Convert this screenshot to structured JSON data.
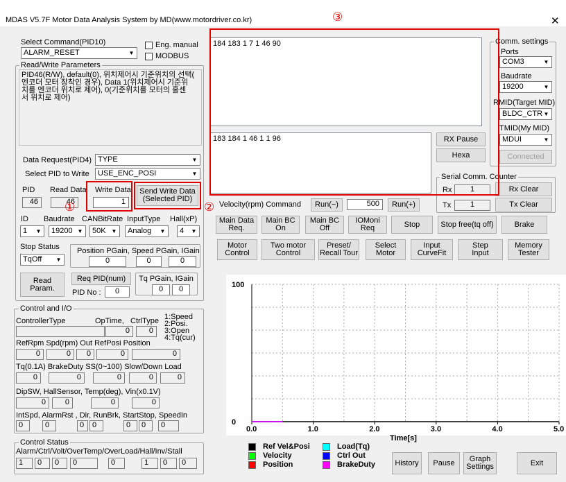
{
  "window": {
    "title": "MDAS V5.7F Motor Data Analysis System by MD(www.motordriver.co.kr)",
    "close": "✕"
  },
  "command": {
    "label": "Select Command(PID10)",
    "value": "ALARM_RESET",
    "eng_manual": "Eng. manual",
    "modbus": "MODBUS"
  },
  "rw": {
    "title": "Read/Write Parameters",
    "description": "PID46(R/W), default(0), 위치제어시 기준위치의 선택(\n엔코더 모터 장착인 경우), Data 1(위치제어시 기준위\n치를 엔코더 위치로 제어), 0(기준위치를 모터의 홀센\n서 위치로 제어)",
    "data_request_label": "Data Request(PID4)",
    "data_request_value": "TYPE",
    "select_pid_label": "Select PID to Write",
    "select_pid_value": "USE_ENC_POSI",
    "pid_label": "PID",
    "pid_value": "46",
    "read_data_label": "Read Data",
    "read_data_value": "46",
    "write_data_label": "Write Data",
    "write_data_value": "1",
    "send_button": "Send Write Data\n(Selected PID)",
    "id_label": "ID",
    "id_value": "1",
    "baud_label": "Baudrate",
    "baud_value": "19200",
    "can_label": "CANBitRate",
    "can_value": "50K",
    "inputtype_label": "InputType",
    "inputtype_value": "Analog",
    "hall_label": "Hall(xP)",
    "hall_value": "4",
    "stop_status_label": "Stop Status",
    "stop_status_value": "TqOff",
    "gains_label": "Position PGain, Speed PGain, IGain",
    "gains": [
      "0",
      "0",
      "0"
    ],
    "read_param": "Read\nParam.",
    "req_pid": "Req PID(num)",
    "pid_no_label": "PID No :",
    "pid_no_value": "0",
    "tq_label": "Tq PGain, IGain",
    "tq": [
      "0",
      "0"
    ]
  },
  "control_io": {
    "title": "Control and I/O",
    "controller_type": "ControllerType",
    "optime": "OpTime,",
    "ctrltype": "CtrlType",
    "ctrl_legend": [
      "1:Speed",
      "2:Posi.",
      "3:Open",
      "4:Tq(cur)"
    ],
    "optime_value": "0",
    "ctrltype_value": "0",
    "row1_label": "RefRpm  Spd(rpm)  Out  RefPosi     Position",
    "row1": [
      "0",
      "0",
      "0",
      "0",
      "0"
    ],
    "row2_label": "Tq(0.1A)  BrakeDuty  SS(0~100)  Slow/Down  Load",
    "row2": [
      "0",
      "0",
      "0",
      "0",
      "0"
    ],
    "row3_label": "DipSW,  HallSensor,     Temp(deg),  Vin(x0.1V)",
    "row3": [
      "0",
      "0",
      "0",
      "0"
    ],
    "row4_label": "IntSpd,  AlarmRst ,  Dir,  RunBrk,  StartStop,  SpeedIn",
    "row4": [
      "0",
      "0",
      "0",
      "0",
      "0",
      "0",
      "0"
    ]
  },
  "control_status": {
    "title": "Control Status",
    "label": "Alarm/Ctrl/Volt/OverTemp/OverLoad/Hall/Inv/Stall",
    "values": [
      "1",
      "0",
      "0",
      "0",
      "0",
      "1",
      "0",
      "0"
    ]
  },
  "comm": {
    "rx_text": "184 183 1 7 1 46 90",
    "tx_text": "183 184 1 46 1 1 96",
    "rx_pause": "RX Pause",
    "hexa": "Hexa",
    "settings_title": "Comm. settings",
    "ports_label": "Ports",
    "ports_value": "COM3",
    "baud_label": "Baudrate",
    "baud_value": "19200",
    "rmid_label": "RMID(Target MID)",
    "rmid_value": "BLDC_CTR",
    "tmid_label": "TMID(My MID)",
    "tmid_value": "MDUI",
    "connected": "Connected",
    "counter_title": "Serial Comm. Counter",
    "rx_label": "Rx",
    "rx_count": "1",
    "rx_clear": "Rx Clear",
    "tx_label": "Tx",
    "tx_count": "1",
    "tx_clear": "Tx Clear"
  },
  "velocity": {
    "label": "Velocity(rpm) Command",
    "run_minus": "Run(−)",
    "value": "500",
    "run_plus": "Run(+)"
  },
  "buttons_row1": [
    "Main Data\nReq.",
    "Main BC\nOn",
    "Main BC\nOff",
    "IOMoni\nReq",
    "Stop",
    "Stop free(tq off)",
    "Brake"
  ],
  "buttons_row2": [
    "Motor\nControl",
    "Two motor\nControl",
    "Preset/\nRecall Tour",
    "Select\nMotor",
    "Input\nCurveFit",
    "Step\nInput",
    "Memory\nTester"
  ],
  "chart_data": {
    "type": "line",
    "xlabel": "Time[s]",
    "ylim": [
      0,
      100
    ],
    "xlim": [
      0,
      5
    ],
    "y_ticks": [
      "100",
      "0"
    ],
    "x_ticks": [
      "0.0",
      "1.0",
      "2.0",
      "3.0",
      "4.0",
      "5.0"
    ],
    "grid": true,
    "series": [
      {
        "name": "Ref Vel&Posi",
        "color": "#000000",
        "x": [
          0,
          0.5
        ],
        "y": [
          0,
          0
        ]
      },
      {
        "name": "Velocity",
        "color": "#00ff00",
        "x": [
          0,
          0.5
        ],
        "y": [
          0,
          0
        ]
      },
      {
        "name": "Position",
        "color": "#ff0000",
        "x": [
          0,
          0.5
        ],
        "y": [
          0,
          0
        ]
      },
      {
        "name": "Load(Tq)",
        "color": "#00ffff",
        "x": [
          0,
          0.5
        ],
        "y": [
          0,
          0
        ]
      },
      {
        "name": "Ctrl Out",
        "color": "#0000ff",
        "x": [
          0,
          0.5
        ],
        "y": [
          0,
          0
        ]
      },
      {
        "name": "BrakeDuty",
        "color": "#ff00ff",
        "x": [
          0,
          0.5
        ],
        "y": [
          0,
          0
        ]
      }
    ]
  },
  "bottom_buttons": {
    "history": "History",
    "pause": "Pause",
    "graph": "Graph\nSettings",
    "exit": "Exit"
  },
  "annotations": [
    "①",
    "②",
    "③"
  ]
}
